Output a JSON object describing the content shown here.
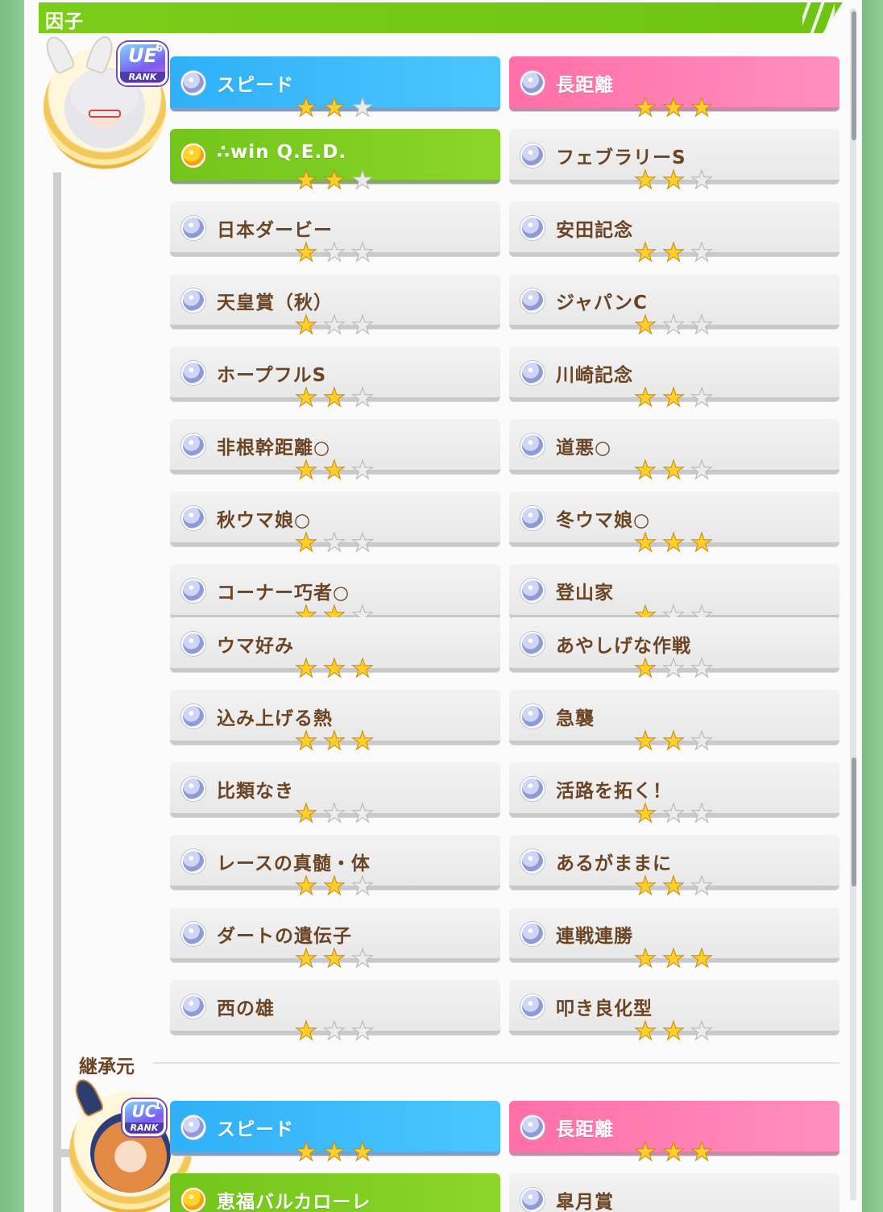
{
  "header": {
    "title": "因子"
  },
  "section2_label": "継承元",
  "parent1": {
    "rank_main": "UE",
    "rank_num": "6",
    "rank_sub": "RANK",
    "factors": [
      {
        "label": "スピード",
        "stars": 2,
        "style": "blue",
        "gem": "silver"
      },
      {
        "label": "長距離",
        "stars": 3,
        "style": "pink",
        "gem": "silver"
      },
      {
        "label": "∴win Q.E.D.",
        "stars": 2,
        "style": "green",
        "gem": "gold"
      },
      {
        "label": "フェブラリーS",
        "stars": 2,
        "style": "white",
        "gem": "silver"
      },
      {
        "label": "日本ダービー",
        "stars": 1,
        "style": "white",
        "gem": "silver"
      },
      {
        "label": "安田記念",
        "stars": 2,
        "style": "white",
        "gem": "silver"
      },
      {
        "label": "天皇賞（秋）",
        "stars": 1,
        "style": "white",
        "gem": "silver"
      },
      {
        "label": "ジャパンC",
        "stars": 1,
        "style": "white",
        "gem": "silver"
      },
      {
        "label": "ホープフルS",
        "stars": 2,
        "style": "white",
        "gem": "silver"
      },
      {
        "label": "川崎記念",
        "stars": 2,
        "style": "white",
        "gem": "silver"
      },
      {
        "label": "非根幹距離○",
        "stars": 2,
        "style": "white",
        "gem": "silver"
      },
      {
        "label": "道悪○",
        "stars": 2,
        "style": "white",
        "gem": "silver"
      },
      {
        "label": "秋ウマ娘○",
        "stars": 1,
        "style": "white",
        "gem": "silver"
      },
      {
        "label": "冬ウマ娘○",
        "stars": 3,
        "style": "white",
        "gem": "silver"
      },
      {
        "label": "コーナー巧者○",
        "stars": 2,
        "style": "white",
        "gem": "silver"
      },
      {
        "label": "登山家",
        "stars": 1,
        "style": "white",
        "gem": "silver"
      },
      {
        "label": "ウマ好み",
        "stars": 3,
        "style": "white",
        "gem": "silver"
      },
      {
        "label": "あやしげな作戦",
        "stars": 1,
        "style": "white",
        "gem": "silver"
      },
      {
        "label": "込み上げる熱",
        "stars": 3,
        "style": "white",
        "gem": "silver"
      },
      {
        "label": "急襲",
        "stars": 2,
        "style": "white",
        "gem": "silver"
      },
      {
        "label": "比類なき",
        "stars": 1,
        "style": "white",
        "gem": "silver"
      },
      {
        "label": "活路を拓く！",
        "stars": 1,
        "style": "white",
        "gem": "silver"
      },
      {
        "label": "レースの真髄・体",
        "stars": 2,
        "style": "white",
        "gem": "silver"
      },
      {
        "label": "あるがままに",
        "stars": 2,
        "style": "white",
        "gem": "silver"
      },
      {
        "label": "ダートの遺伝子",
        "stars": 2,
        "style": "white",
        "gem": "silver"
      },
      {
        "label": "連戦連勝",
        "stars": 3,
        "style": "white",
        "gem": "silver"
      },
      {
        "label": "西の雄",
        "stars": 1,
        "style": "white",
        "gem": "silver"
      },
      {
        "label": "叩き良化型",
        "stars": 2,
        "style": "white",
        "gem": "silver"
      }
    ]
  },
  "parent2": {
    "rank_main": "UC",
    "rank_num": "1",
    "rank_sub": "RANK",
    "factors": [
      {
        "label": "スピード",
        "stars": 3,
        "style": "blue",
        "gem": "silver"
      },
      {
        "label": "長距離",
        "stars": 3,
        "style": "pink",
        "gem": "silver"
      },
      {
        "label": "恵福バルカローレ",
        "stars": 0,
        "style": "green",
        "gem": "gold"
      },
      {
        "label": "皐月賞",
        "stars": 0,
        "style": "white",
        "gem": "silver"
      }
    ]
  },
  "colors": {
    "header_green": "#7ccd1a",
    "speed_blue": "#2fb0f7",
    "distance_pink": "#ff6fa7",
    "unique_green": "#72c51a",
    "label_brown": "#6b4424",
    "star_gold": "#ffcf2a"
  },
  "icons": {
    "gem": "factor-gem-icon",
    "star": "star-icon"
  }
}
